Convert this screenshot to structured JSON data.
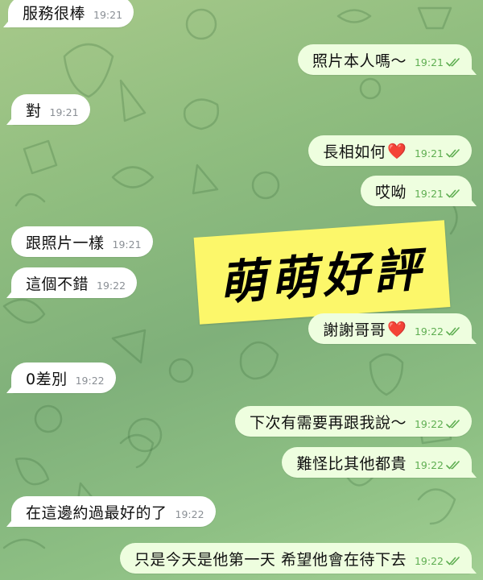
{
  "sticker": {
    "text": "萌萌好評"
  },
  "messages": [
    {
      "text": "服務很棒",
      "time": "19:21",
      "direction": "incoming"
    },
    {
      "text": "照片本人嗎～",
      "time": "19:21",
      "direction": "outgoing",
      "status": "read"
    },
    {
      "text": "對",
      "time": "19:21",
      "direction": "incoming"
    },
    {
      "text": "長相如何",
      "emoji": "❤️",
      "time": "19:21",
      "direction": "outgoing",
      "status": "read"
    },
    {
      "text": "哎呦",
      "time": "19:21",
      "direction": "outgoing",
      "status": "read"
    },
    {
      "text": "跟照片一樣",
      "time": "19:21",
      "direction": "incoming"
    },
    {
      "text": "這個不錯",
      "time": "19:22",
      "direction": "incoming"
    },
    {
      "text": "謝謝哥哥",
      "emoji": "❤️",
      "time": "19:22",
      "direction": "outgoing",
      "status": "read"
    },
    {
      "text": "0差別",
      "time": "19:22",
      "direction": "incoming"
    },
    {
      "text": "下次有需要再跟我說～",
      "time": "19:22",
      "direction": "outgoing",
      "status": "read"
    },
    {
      "text": "難怪比其他都貴",
      "time": "19:22",
      "direction": "outgoing",
      "status": "read"
    },
    {
      "text": "在這邊約過最好的了",
      "time": "19:22",
      "direction": "incoming"
    },
    {
      "text": "只是今天是他第一天 希望他會在待下去",
      "time": "19:22",
      "direction": "outgoing",
      "status": "read"
    }
  ],
  "colors": {
    "incoming_bubble": "#ffffff",
    "outgoing_bubble": "#eefedf",
    "read_check": "#5fae52",
    "sticker_bg": "#fcf76a",
    "wallpaper": "#8fbd7f"
  },
  "icons": {
    "read_receipt": "double-check-icon",
    "heart": "red-heart-emoji"
  }
}
